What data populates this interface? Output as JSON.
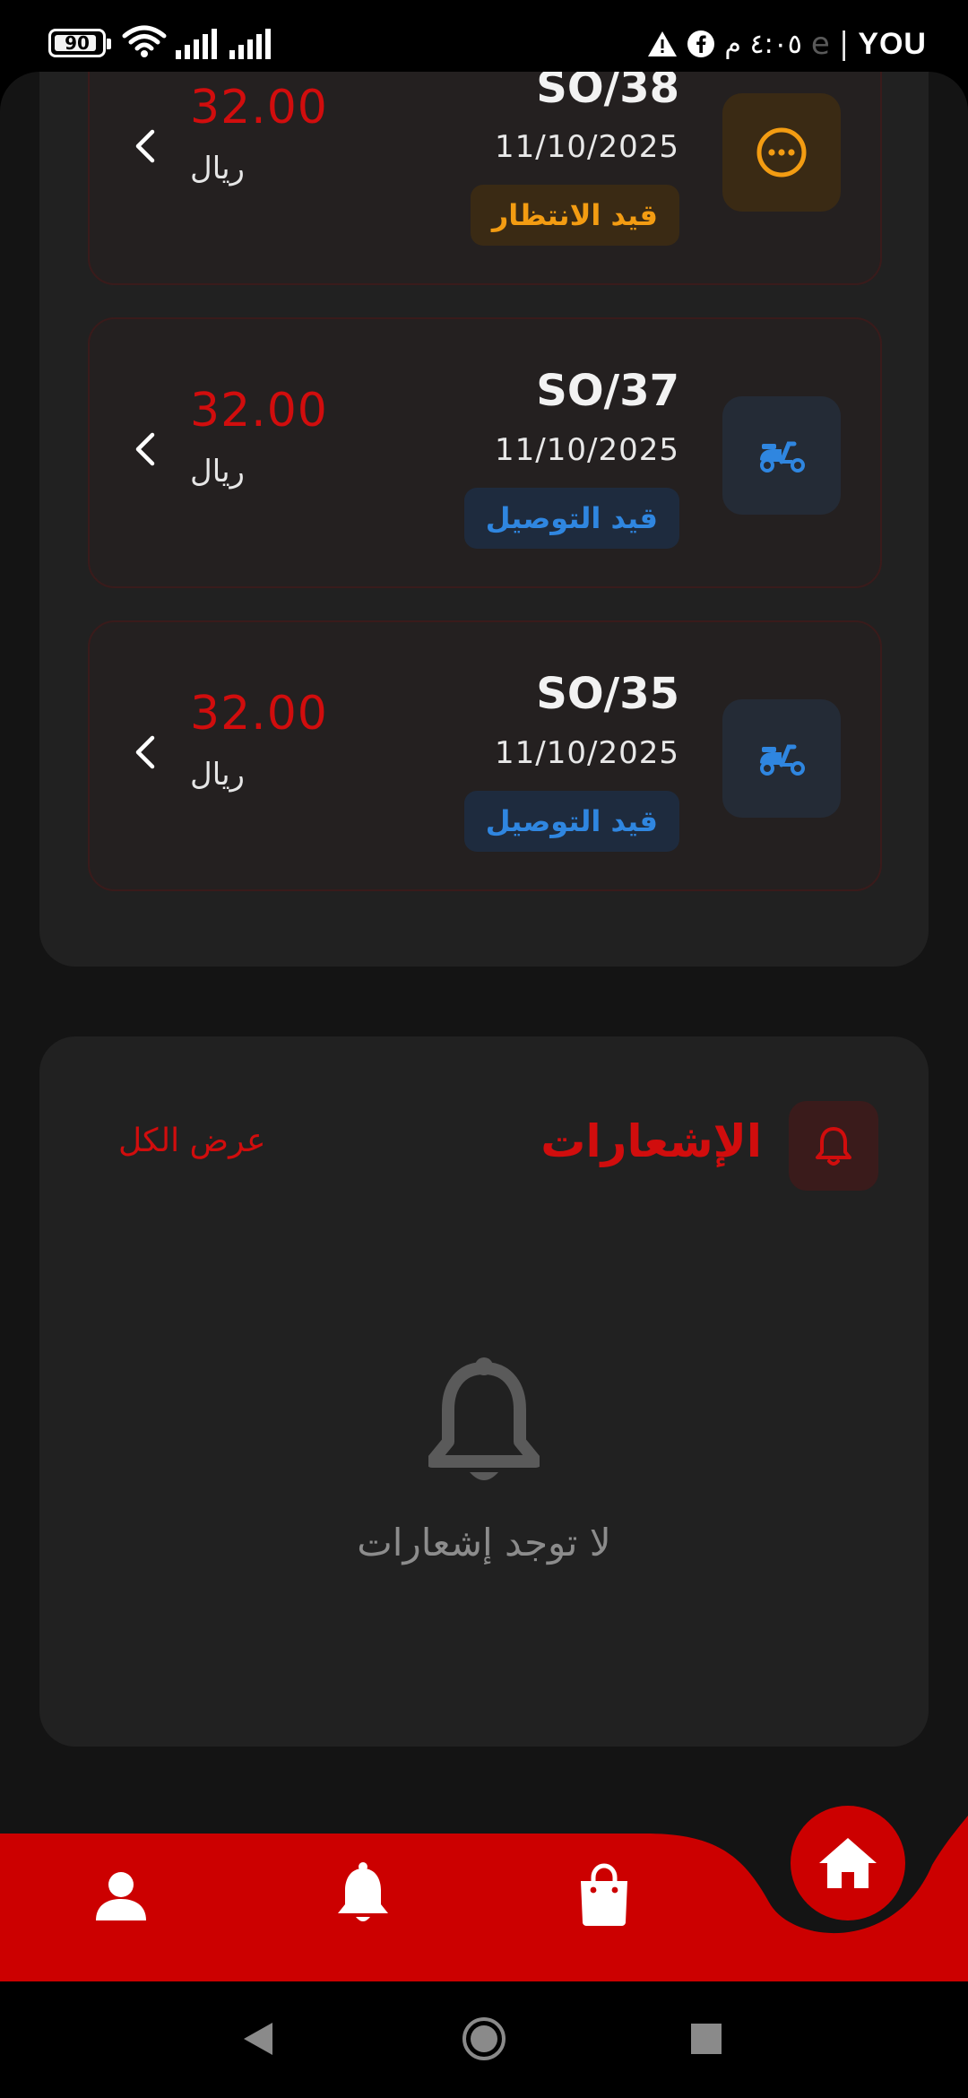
{
  "status_bar": {
    "battery_level": "90",
    "carrier": "YOU",
    "separator": "|",
    "faded_text": "e",
    "time": "٤:٠٥ م"
  },
  "orders": [
    {
      "ref": "SO/38",
      "date": "11/10/2025",
      "status": "قيد الانتظار",
      "status_type": "pending",
      "amount": "32.00",
      "currency": "ريال",
      "icon": "ellipsis-circle-icon"
    },
    {
      "ref": "SO/37",
      "date": "11/10/2025",
      "status": "قيد التوصيل",
      "status_type": "delivery",
      "amount": "32.00",
      "currency": "ريال",
      "icon": "scooter-icon"
    },
    {
      "ref": "SO/35",
      "date": "11/10/2025",
      "status": "قيد التوصيل",
      "status_type": "delivery",
      "amount": "32.00",
      "currency": "ريال",
      "icon": "scooter-icon"
    }
  ],
  "notifications": {
    "title": "الإشعارات",
    "view_all": "عرض الكل",
    "empty_text": "لا توجد إشعارات"
  },
  "bottom_nav": {
    "items": [
      "profile-icon",
      "bell-icon",
      "shopping-bag-icon",
      "home-icon"
    ],
    "accent_color": "#cc0000"
  },
  "colors": {
    "accent": "#d10d0d",
    "pending": "#f39c12",
    "delivery": "#2f86e0",
    "panel": "#212121",
    "background": "#141414"
  }
}
